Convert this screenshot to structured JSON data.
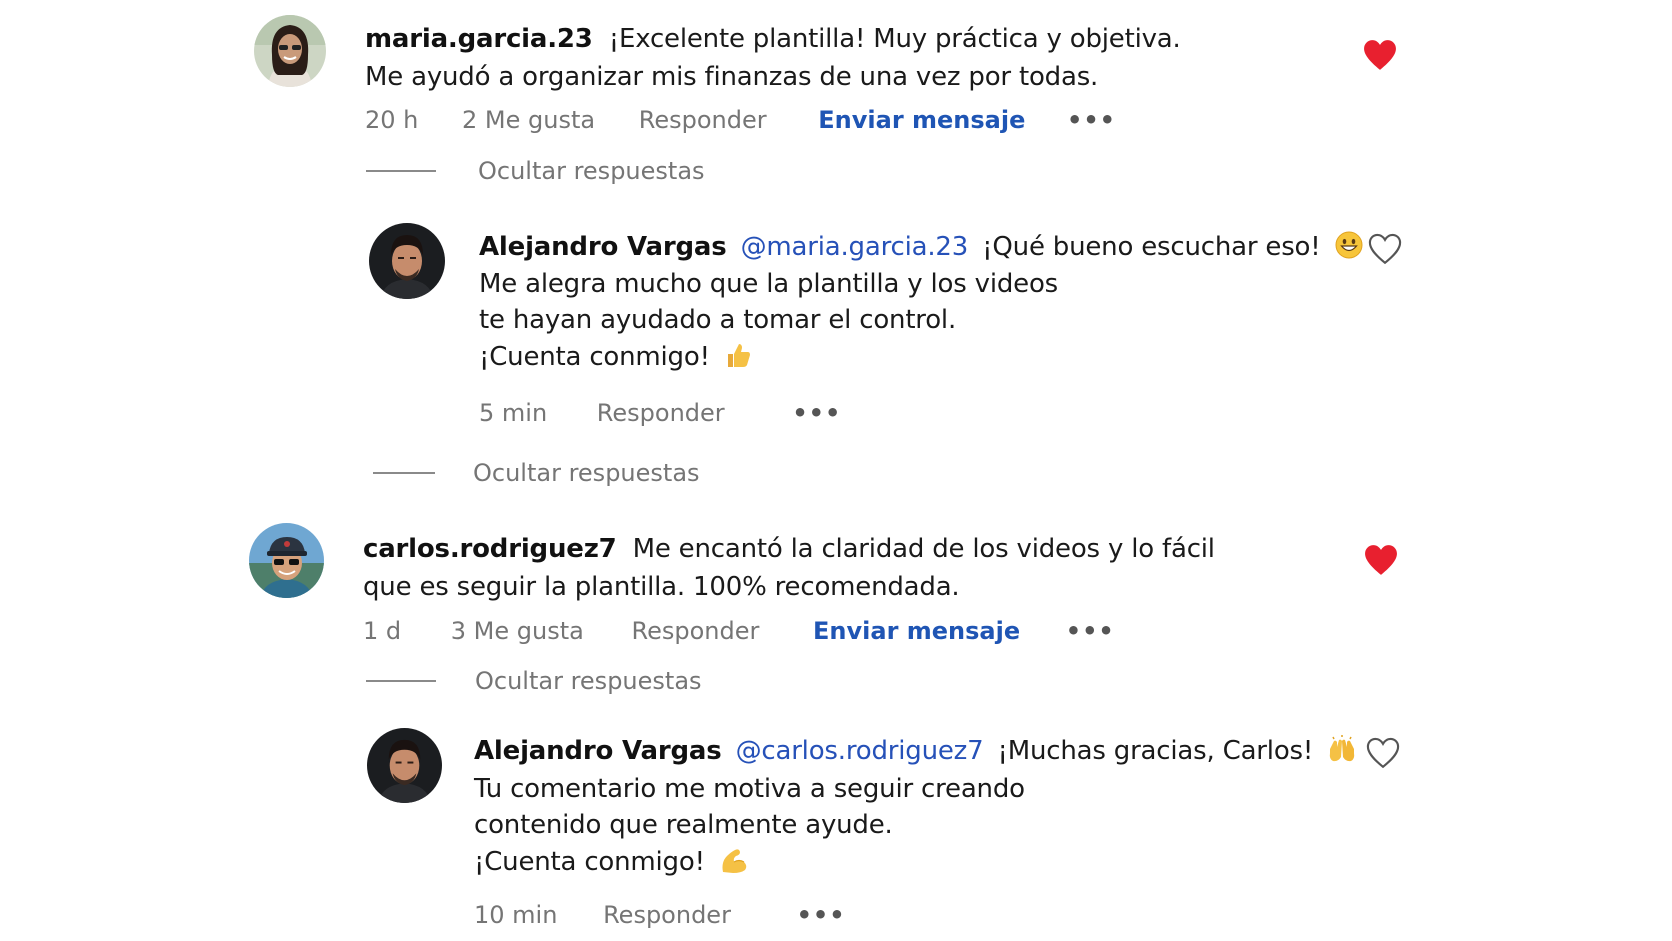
{
  "comments": [
    {
      "username": "maria.garcia.23",
      "text_line1": "¡Excelente plantilla! Muy práctica y objetiva.",
      "text_line2": "Me ayudó a organizar mis finanzas de una vez por todas.",
      "time": "20 h",
      "likes": "2 Me gusta",
      "reply_label": "Responder",
      "send_label": "Enviar mensaje",
      "more": "•••",
      "liked": true,
      "hide_replies": "Ocultar respuestas",
      "reply": {
        "username": "Alejandro Vargas",
        "mention": "@maria.garcia.23",
        "text_line1": "¡Qué bueno escuchar eso!",
        "text_line2": "Me alegra mucho que la plantilla y los videos",
        "text_line3": "te hayan ayudado a tomar el control.",
        "text_line4": "¡Cuenta conmigo!",
        "time": "5 min",
        "reply_label": "Responder",
        "more": "•••",
        "liked": false,
        "emoji1": "grinning-face-icon",
        "emoji2": "thumbs-up-icon"
      },
      "hide_replies_after": "Ocultar respuestas"
    },
    {
      "username": "carlos.rodriguez7",
      "text_line1": "Me encantó la claridad de los videos y lo fácil",
      "text_line2": "que es seguir la plantilla. 100% recomendada.",
      "time": "1 d",
      "likes": "3 Me gusta",
      "reply_label": "Responder",
      "send_label": "Enviar mensaje",
      "more": "•••",
      "liked": true,
      "hide_replies": "Ocultar respuestas",
      "reply": {
        "username": "Alejandro Vargas",
        "mention": "@carlos.rodriguez7",
        "text_line1": "¡Muchas gracias, Carlos!",
        "text_line2": "Tu comentario me motiva a seguir creando",
        "text_line3": "contenido que realmente ayude.",
        "text_line4": "¡Cuenta conmigo!",
        "time": "10 min",
        "reply_label": "Responder",
        "more": "•••",
        "liked": false,
        "emoji1": "raising-hands-icon",
        "emoji2": "flexed-biceps-icon"
      }
    }
  ],
  "colors": {
    "heart_red": "#e8202f",
    "mention_blue": "#2651b8",
    "send_blue": "#1f55b4",
    "meta_gray": "#757575"
  }
}
